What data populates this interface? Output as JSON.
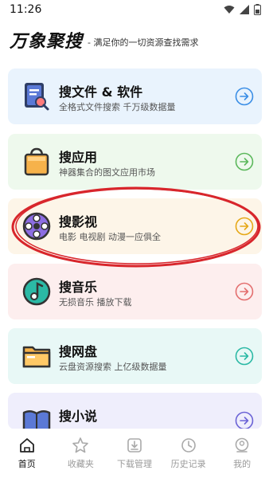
{
  "status": {
    "time": "11:26"
  },
  "header": {
    "brand": "万象聚搜",
    "slogan": "- 满足你的一切资源查找需求"
  },
  "cards": [
    {
      "title": "搜文件 & 软件",
      "desc": "全格式文件搜索 千万级数据量",
      "accent": "#3b8ee6",
      "icon": "document-search-icon"
    },
    {
      "title": "搜应用",
      "desc": "神器集合的图文应用市场",
      "accent": "#5cb85c",
      "icon": "shopping-bag-icon"
    },
    {
      "title": "搜影视",
      "desc": "电影 电视剧 动漫一应俱全",
      "accent": "#e6a817",
      "icon": "film-reel-icon"
    },
    {
      "title": "搜音乐",
      "desc": "无损音乐 播放下载",
      "accent": "#e36f6f",
      "icon": "music-note-icon"
    },
    {
      "title": "搜网盘",
      "desc": "云盘资源搜索 上亿级数据量",
      "accent": "#2bb9a5",
      "icon": "folder-icon"
    },
    {
      "title": "搜小说",
      "desc": "",
      "accent": "#6b63d6",
      "icon": "book-icon"
    }
  ],
  "tabs": [
    {
      "label": "首页",
      "icon": "home-icon",
      "active": true
    },
    {
      "label": "收藏夹",
      "icon": "star-icon",
      "active": false
    },
    {
      "label": "下载管理",
      "icon": "download-icon",
      "active": false
    },
    {
      "label": "历史记录",
      "icon": "history-icon",
      "active": false
    },
    {
      "label": "我的",
      "icon": "profile-icon",
      "active": false
    }
  ]
}
